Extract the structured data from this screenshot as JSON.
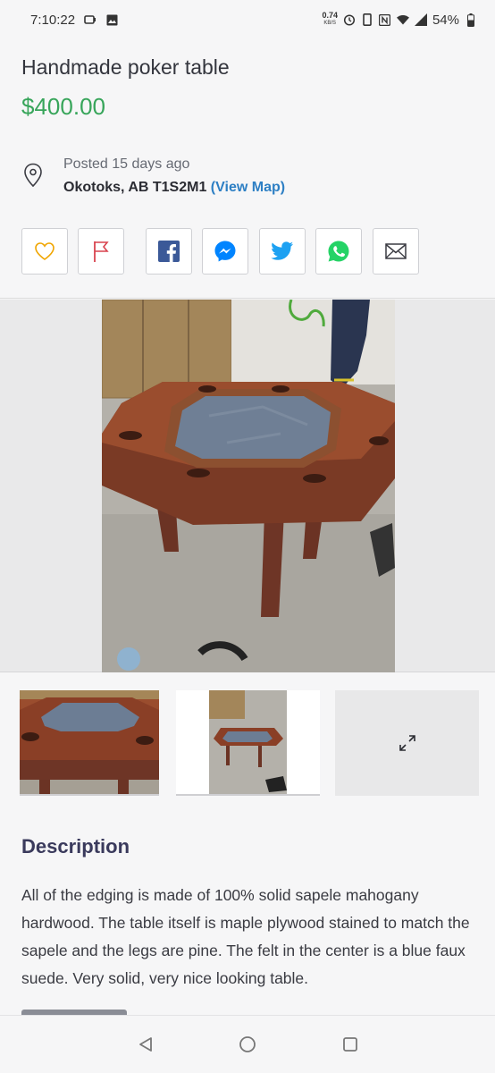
{
  "status_bar": {
    "time": "7:10:22",
    "net_speed_value": "0.74",
    "net_speed_unit": "KB/S",
    "battery": "54%",
    "icons": [
      "screen-record-icon",
      "image-icon",
      "alarm-icon",
      "vibrate-icon",
      "nfc-icon",
      "wifi-icon",
      "signal-icon",
      "battery-icon"
    ]
  },
  "listing": {
    "title": "Handmade poker table",
    "price": "$400.00",
    "posted": "Posted 15 days ago",
    "location": "Okotoks, AB T1S2M1",
    "map_link": "(View Map)"
  },
  "actions": [
    "favorite-heart",
    "report-flag",
    "share-facebook",
    "share-messenger",
    "share-twitter",
    "share-whatsapp",
    "share-email"
  ],
  "colors": {
    "price": "#37a55a",
    "link": "#2d7fc4",
    "heart": "#f0a500",
    "flag": "#d9434e",
    "facebook": "#3b5998",
    "messenger": "#0084ff",
    "twitter": "#1da1f2",
    "whatsapp": "#25d366"
  },
  "description": {
    "heading": "Description",
    "text": "All of the edging is made of 100% solid sapele mahogany hardwood. The table itself is maple plywood stained to match the sapele and the legs are pine. The felt in the center is a blue faux suede. Very solid, very nice looking table."
  },
  "nav": [
    "back-icon",
    "home-icon",
    "recents-icon"
  ]
}
